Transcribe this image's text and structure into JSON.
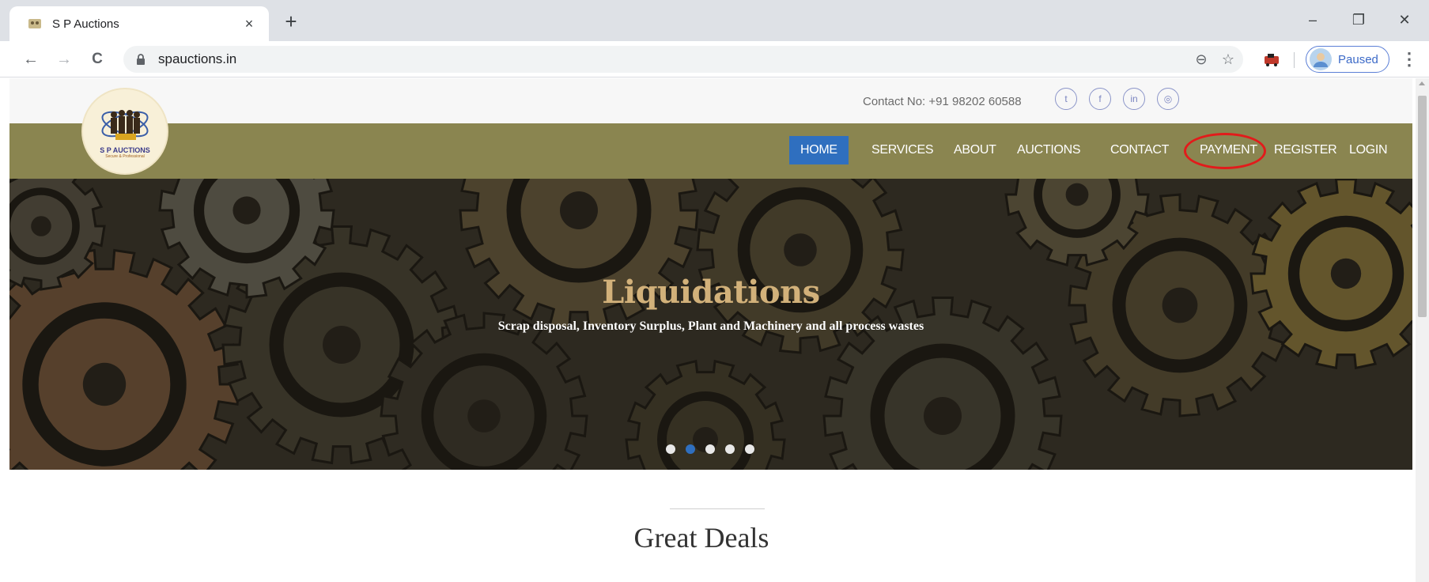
{
  "browser": {
    "tab_title": "S P Auctions",
    "tab_close": "×",
    "new_tab": "+",
    "url": "spauctions.in",
    "profile_status": "Paused",
    "accent_color": "#3c6ac8",
    "window_controls": {
      "minimize": "–",
      "restore": "❐",
      "close": "✕"
    },
    "nav": {
      "back": "←",
      "forward": "→",
      "reload": "C"
    },
    "omni_icons": {
      "zoom": "⊖",
      "bookmark": "☆"
    },
    "menu": "⋮"
  },
  "site": {
    "contact": "Contact No: +91 98202 60588",
    "social": [
      {
        "name": "twitter-icon",
        "glyph": "t"
      },
      {
        "name": "facebook-icon",
        "glyph": "f"
      },
      {
        "name": "linkedin-icon",
        "glyph": "in"
      },
      {
        "name": "dribbble-icon",
        "glyph": "◎"
      }
    ],
    "logo": {
      "text": "S P AUCTIONS",
      "sub": "Secure & Professional"
    },
    "nav": [
      {
        "label": "HOME",
        "active": true
      },
      {
        "label": "SERVICES"
      },
      {
        "label": "ABOUT"
      },
      {
        "label": "AUCTIONS"
      },
      {
        "label": "CONTACT"
      },
      {
        "label": "PAYMENT",
        "highlighted": true
      },
      {
        "label": "REGISTER"
      },
      {
        "label": "LOGIN"
      }
    ],
    "navbar_color": "#8a8550",
    "active_color": "#2f6fbf",
    "highlight_color": "#e21b1b",
    "hero": {
      "title": "Liquidations",
      "subtitle": "Scrap disposal, Inventory Surplus, Plant and Machinery and all process wastes",
      "slides": 5,
      "active_slide": 2
    },
    "section_title": "Great Deals"
  }
}
